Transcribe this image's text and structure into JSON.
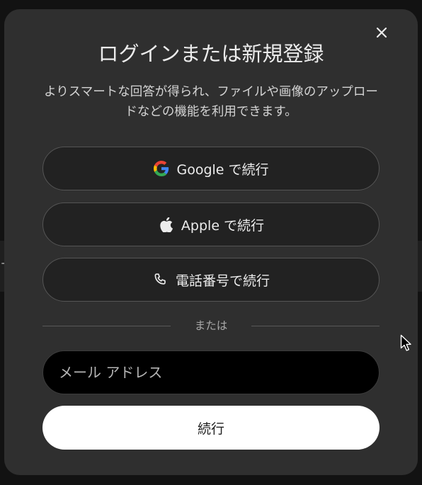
{
  "modal": {
    "title": "ログインまたは新規登録",
    "subtitle": "よりスマートな回答が得られ、ファイルや画像のアップロードなどの機能を利用できます。",
    "close_icon": "close-icon"
  },
  "auth_buttons": [
    {
      "label": "Google で続行",
      "icon": "google-icon"
    },
    {
      "label": "Apple で続行",
      "icon": "apple-icon"
    },
    {
      "label": "電話番号で続行",
      "icon": "phone-icon"
    }
  ],
  "divider": {
    "label": "または"
  },
  "email": {
    "placeholder": "メール アドレス",
    "value": ""
  },
  "continue": {
    "label": "続行"
  },
  "colors": {
    "modal_bg": "#2f2f2f",
    "button_bg": "#222222",
    "input_bg": "#000000",
    "primary_button_bg": "#ffffff",
    "text": "#ececec"
  }
}
